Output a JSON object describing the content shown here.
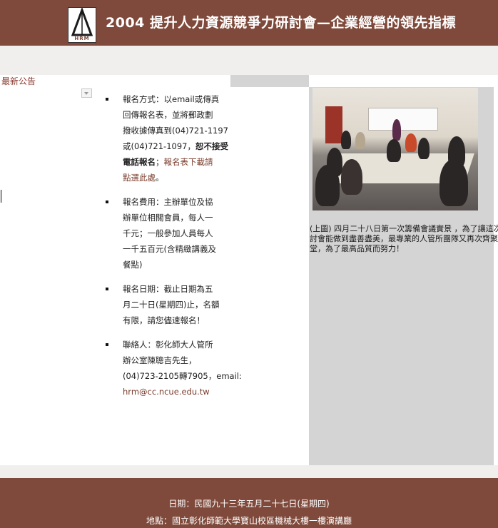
{
  "header": {
    "title": "2004  提升人力資源競爭力研討會—企業經營的領先指標",
    "logo_text": "HRM"
  },
  "news": {
    "label": "最新公告"
  },
  "items": [
    {
      "lines": [
        {
          "parts": [
            {
              "text": "報名方式：以email或傳真",
              "style": ""
            }
          ]
        },
        {
          "parts": [
            {
              "text": "回傳報名表，並將郵政劃",
              "style": ""
            }
          ]
        },
        {
          "parts": [
            {
              "text": "撥收據傳真到(04)721-1197",
              "style": ""
            }
          ]
        },
        {
          "parts": [
            {
              "text": "或(04)721-1097，",
              "style": ""
            },
            {
              "text": "恕不接受",
              "style": "bold"
            }
          ]
        },
        {
          "parts": [
            {
              "text": "電話報名",
              "style": "bold"
            },
            {
              "text": "；",
              "style": ""
            },
            {
              "text": "報名表下載請",
              "style": "red"
            }
          ]
        },
        {
          "parts": [
            {
              "text": "點選此處",
              "style": "red"
            },
            {
              "text": "。",
              "style": ""
            }
          ]
        }
      ]
    },
    {
      "lines": [
        {
          "parts": [
            {
              "text": "報名費用：主辦單位及協",
              "style": ""
            }
          ]
        },
        {
          "parts": [
            {
              "text": "辦單位相關會員，每人一",
              "style": ""
            }
          ]
        },
        {
          "parts": [
            {
              "text": "千元；一般參加人員每人",
              "style": ""
            }
          ]
        },
        {
          "parts": [
            {
              "text": "一千五百元(含精緻講義及",
              "style": ""
            }
          ]
        },
        {
          "parts": [
            {
              "text": "餐點)",
              "style": ""
            }
          ]
        }
      ]
    },
    {
      "lines": [
        {
          "parts": [
            {
              "text": "報名日期：截止日期為五",
              "style": ""
            }
          ]
        },
        {
          "parts": [
            {
              "text": "月二十日(星期四)止，名額",
              "style": ""
            }
          ]
        },
        {
          "parts": [
            {
              "text": "有限，請您儘速報名！",
              "style": ""
            }
          ]
        }
      ]
    },
    {
      "lines": [
        {
          "parts": [
            {
              "text": "聯絡人：彰化師大人管所",
              "style": ""
            }
          ]
        },
        {
          "parts": [
            {
              "text": "辦公室陳聰吉先生，",
              "style": ""
            }
          ]
        },
        {
          "parts": [
            {
              "text": "(04)723-2105轉7905，email:",
              "style": ""
            }
          ]
        },
        {
          "parts": [
            {
              "text": "hrm@cc.ncue.edu.tw",
              "style": "red"
            }
          ]
        }
      ]
    }
  ],
  "photo": {
    "caption_lines": [
      "(上圖) 四月二十八日第一次籌備會議實景 ，為了讓這次研",
      "討會能做到盡善盡美，最專業的人管所團隊又再次齊聚一",
      "堂，為了最高品質而努力！"
    ]
  },
  "footer": {
    "date_line": "日期：民國九十三年五月二十七日(星期四)",
    "place_line": "地點：國立彰化師範大學寶山校區機械大樓一樓演講廳"
  },
  "colors": {
    "brand": "#7f4a3b",
    "accent_text": "#7a3b2a",
    "panel_gray": "#d4d4d4"
  }
}
